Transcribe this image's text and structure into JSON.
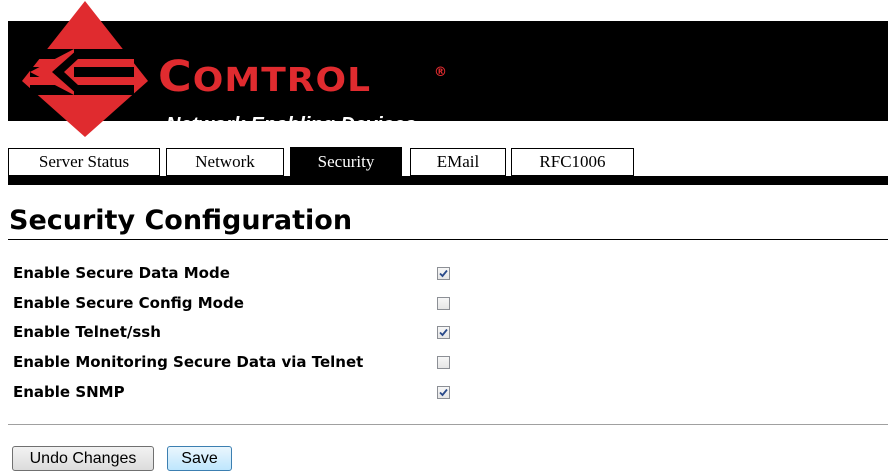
{
  "header": {
    "brand_prefix": "C",
    "brand_rest": "OMTROL",
    "registered_mark": "®",
    "tagline": "Network Enabling Devices",
    "brand_color": "#e02b2f",
    "logo_icon": "comtrol-diamond-arrow-logo"
  },
  "tabs": [
    {
      "label": "Server Status",
      "active": false
    },
    {
      "label": "Network",
      "active": false
    },
    {
      "label": "Security",
      "active": true
    },
    {
      "label": "EMail",
      "active": false
    },
    {
      "label": "RFC1006",
      "active": false
    }
  ],
  "page": {
    "title": "Security Configuration"
  },
  "settings": [
    {
      "label": "Enable Secure Data Mode",
      "checked": true
    },
    {
      "label": "Enable Secure Config Mode",
      "checked": false
    },
    {
      "label": "Enable Telnet/ssh",
      "checked": true
    },
    {
      "label": "Enable Monitoring Secure Data via Telnet",
      "checked": false
    },
    {
      "label": "Enable SNMP",
      "checked": true
    }
  ],
  "buttons": {
    "undo_label": "Undo Changes",
    "save_label": "Save"
  }
}
